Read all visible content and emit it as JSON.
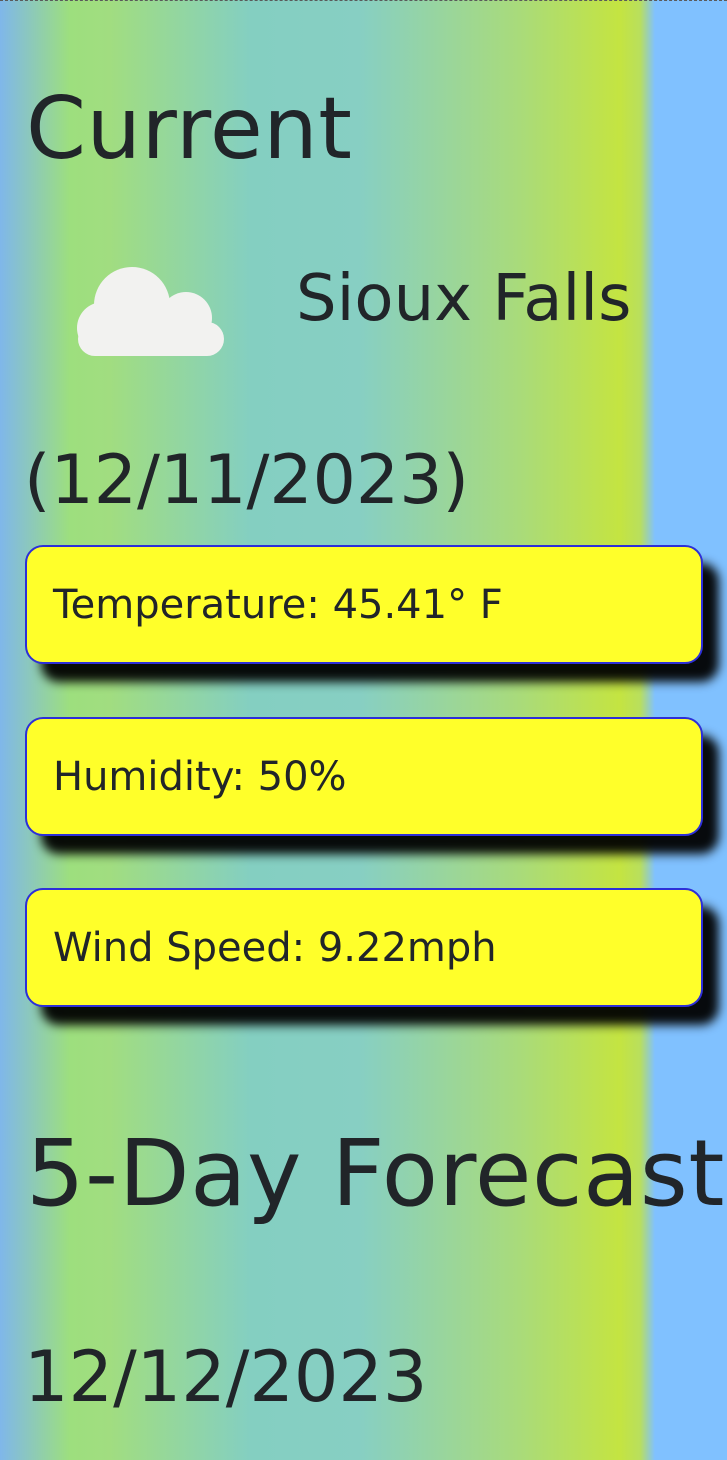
{
  "current": {
    "title": "Current",
    "icon": "cloud-icon",
    "city": "Sioux Falls",
    "date": "(12/11/2023)",
    "stats": {
      "temperature": "Temperature: 45.41° F",
      "humidity": "Humidity: 50%",
      "wind_speed": "Wind Speed: 9.22mph"
    }
  },
  "forecast": {
    "title": "5-Day Forecast",
    "days": [
      {
        "date": "12/12/2023"
      }
    ]
  },
  "colors": {
    "card_background": "#ffff2a",
    "card_border": "#2d2fd8",
    "text": "#212529",
    "cloud": "#f2f2f0"
  }
}
